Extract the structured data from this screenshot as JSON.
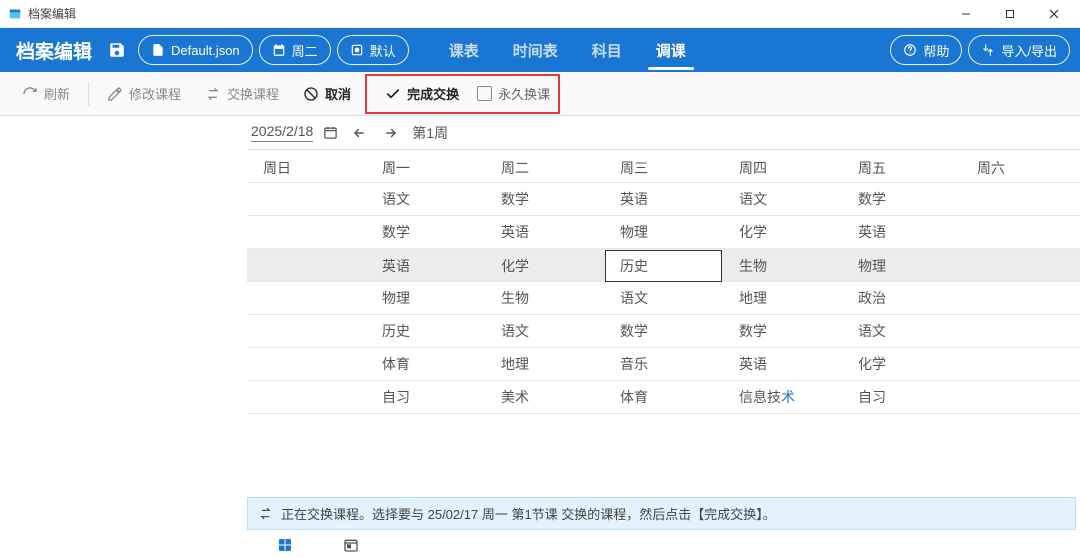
{
  "window": {
    "title": "档案编辑"
  },
  "header": {
    "title": "档案编辑",
    "chips": {
      "file": "Default.json",
      "day": "周二",
      "profile": "默认"
    },
    "tabs": [
      "课表",
      "时间表",
      "科目",
      "调课"
    ],
    "active_tab": 3,
    "help_label": "帮助",
    "import_export_label": "导入/导出"
  },
  "toolbar": {
    "refresh": "刷新",
    "edit_course": "修改课程",
    "swap_course": "交换课程",
    "cancel": "取消",
    "complete_swap": "完成交换",
    "permanent_swap": "永久换课"
  },
  "datenav": {
    "date": "2025/2/18",
    "week_label": "第1周"
  },
  "schedule": {
    "headers": [
      "周日",
      "周一",
      "周二",
      "周三",
      "周四",
      "周五",
      "周六"
    ],
    "rows": [
      [
        "",
        "语文",
        "数学",
        "英语",
        "语文",
        "数学",
        ""
      ],
      [
        "",
        "数学",
        "英语",
        "物理",
        "化学",
        "英语",
        ""
      ],
      [
        "",
        "英语",
        "化学",
        "历史",
        "生物",
        "物理",
        ""
      ],
      [
        "",
        "物理",
        "生物",
        "语文",
        "地理",
        "政治",
        ""
      ],
      [
        "",
        "历史",
        "语文",
        "数学",
        "数学",
        "语文",
        ""
      ],
      [
        "",
        "体育",
        "地理",
        "音乐",
        "英语",
        "化学",
        ""
      ],
      [
        "",
        "自习",
        "美术",
        "体育",
        "信息技术",
        "自习",
        ""
      ]
    ],
    "highlighted_row": 2,
    "selected_cell": {
      "row": 2,
      "col": 3
    },
    "blue_tail": {
      "row": 6,
      "col": 4
    }
  },
  "status": {
    "message": "正在交换课程。选择要与 25/02/17 周一 第1节课 交换的课程，然后点击【完成交换】。"
  }
}
